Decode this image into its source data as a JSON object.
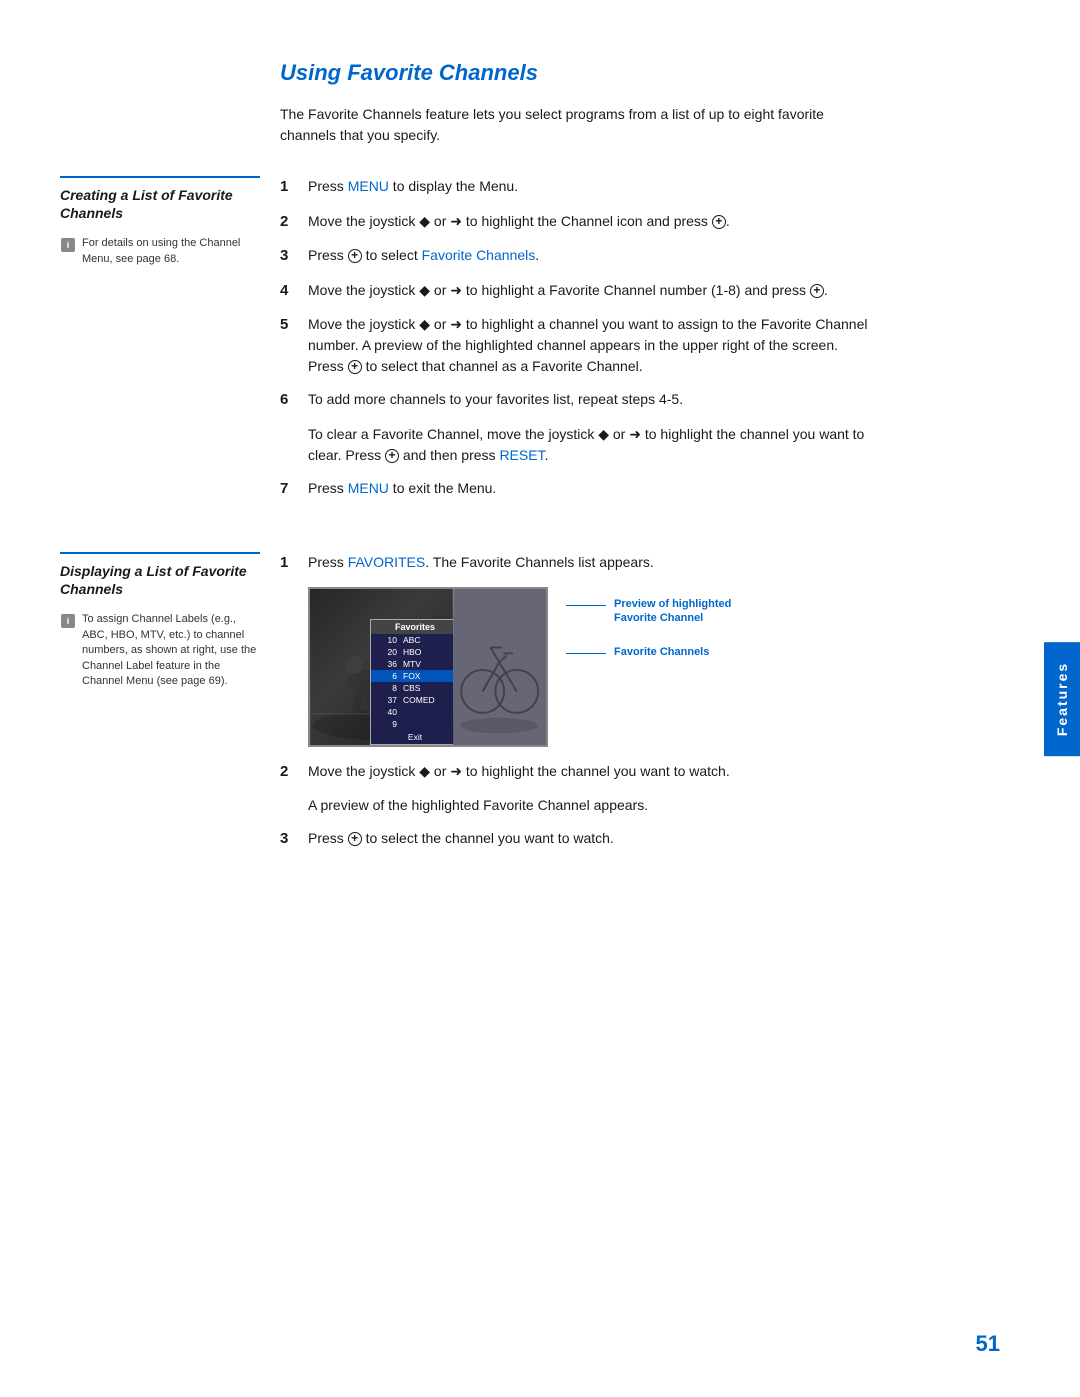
{
  "page": {
    "title": "Using Favorite Channels",
    "number": "51",
    "features_tab": "Features"
  },
  "intro": {
    "text": "The Favorite Channels feature lets you select programs from a list of up to eight favorite channels that you specify."
  },
  "section1": {
    "heading": "Creating a List of Favorite Channels",
    "note": "For details on using the Channel Menu, see page 68.",
    "steps": [
      {
        "num": "1",
        "text_before": "Press ",
        "highlight": "MENU",
        "text_after": " to display the Menu."
      },
      {
        "num": "2",
        "text": "Move the joystick ◆ or ➜ to highlight the Channel icon and press ⊕."
      },
      {
        "num": "3",
        "text_before": "Press ⊕ to select ",
        "highlight": "Favorite Channels",
        "text_after": "."
      },
      {
        "num": "4",
        "text": "Move the joystick ◆ or ➜ to highlight a Favorite Channel number (1-8) and press ⊕."
      },
      {
        "num": "5",
        "text": "Move the joystick ◆ or ➜ to highlight a channel you want to assign to the Favorite Channel number. A preview of the highlighted channel appears in the upper right of the screen. Press ⊕ to select that channel as a Favorite Channel."
      },
      {
        "num": "6",
        "text": "To add more channels to your favorites list, repeat steps 4-5."
      }
    ],
    "sub_note": "To clear a Favorite Channel, move the joystick ◆ or ➜ to highlight the channel you want to clear. Press ⊕ and then press RESET.",
    "step7": {
      "num": "7",
      "text_before": "Press ",
      "highlight": "MENU",
      "text_after": " to exit the Menu."
    }
  },
  "section2": {
    "heading": "Displaying a List of Favorite Channels",
    "note": "To assign Channel Labels (e.g., ABC, HBO, MTV, etc.) to channel numbers, as shown at right, use the Channel Label feature in the Channel Menu (see page 69).",
    "step1": {
      "num": "1",
      "text_before": "Press ",
      "highlight": "FAVORITES",
      "text_after": ". The Favorite Channels list appears."
    },
    "step2": {
      "num": "2",
      "text": "Move the joystick ◆ or ➜ to highlight the channel you want to watch."
    },
    "step2_subnote": "A preview of the highlighted Favorite Channel appears.",
    "step3": {
      "num": "3",
      "text": "Press ⊕ to select the channel you want to watch."
    },
    "favorites_table": {
      "header": "Favorites",
      "rows": [
        {
          "num": "10",
          "label": "ABC"
        },
        {
          "num": "20",
          "label": "HBO"
        },
        {
          "num": "36",
          "label": "MTV"
        },
        {
          "num": "6",
          "label": "FOX"
        },
        {
          "num": "8",
          "label": "CBS"
        },
        {
          "num": "37",
          "label": "COMED"
        },
        {
          "num": "40",
          "label": ""
        },
        {
          "num": "9",
          "label": ""
        }
      ],
      "exit": "Exit"
    },
    "annotation1": {
      "text": "Preview of highlighted Favorite Channel"
    },
    "annotation2": {
      "text": "Favorite Channels"
    }
  }
}
